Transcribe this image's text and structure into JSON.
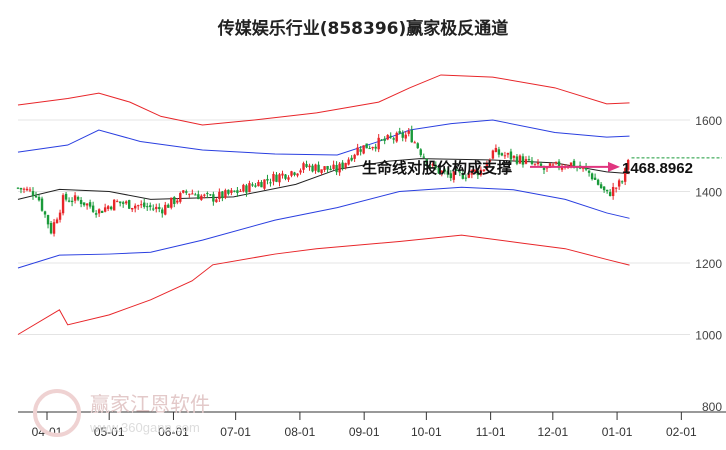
{
  "chart_data": {
    "type": "candlestick",
    "title": "传媒娱乐行业(858396)赢家极反通道",
    "y_ticks": [
      1600,
      1400,
      1200,
      1000,
      800
    ],
    "ylim": [
      800,
      1700
    ],
    "x_ticks": [
      "04-01",
      "05-01",
      "06-01",
      "07-01",
      "08-01",
      "09-01",
      "10-01",
      "11-01",
      "12-01",
      "01-01",
      "02-01"
    ],
    "x_tick_days": [
      0,
      30,
      61,
      91,
      122,
      153,
      183,
      214,
      244,
      275,
      306
    ],
    "close_path": [
      [
        -14,
        1410
      ],
      [
        -5,
        1395
      ],
      [
        2,
        1290
      ],
      [
        8,
        1380
      ],
      [
        16,
        1375
      ],
      [
        25,
        1345
      ],
      [
        33,
        1370
      ],
      [
        45,
        1360
      ],
      [
        55,
        1350
      ],
      [
        68,
        1400
      ],
      [
        78,
        1380
      ],
      [
        90,
        1395
      ],
      [
        100,
        1420
      ],
      [
        115,
        1450
      ],
      [
        125,
        1470
      ],
      [
        140,
        1460
      ],
      [
        150,
        1520
      ],
      [
        165,
        1545
      ],
      [
        175,
        1560
      ],
      [
        185,
        1470
      ],
      [
        195,
        1440
      ],
      [
        210,
        1460
      ],
      [
        215,
        1510
      ],
      [
        228,
        1490
      ],
      [
        240,
        1460
      ],
      [
        252,
        1480
      ],
      [
        262,
        1450
      ],
      [
        270,
        1390
      ],
      [
        278,
        1430
      ],
      [
        281,
        1510
      ]
    ],
    "series": [
      {
        "name": "upper-red",
        "color": "#e8262a",
        "points": [
          [
            -14,
            1642
          ],
          [
            10,
            1660
          ],
          [
            25,
            1675
          ],
          [
            40,
            1650
          ],
          [
            55,
            1610
          ],
          [
            75,
            1586
          ],
          [
            100,
            1600
          ],
          [
            130,
            1620
          ],
          [
            160,
            1650
          ],
          [
            175,
            1690
          ],
          [
            190,
            1726
          ],
          [
            215,
            1720
          ],
          [
            245,
            1690
          ],
          [
            270,
            1645
          ],
          [
            281,
            1648
          ]
        ]
      },
      {
        "name": "upper-blue",
        "color": "#2a3fe0",
        "points": [
          [
            -14,
            1510
          ],
          [
            10,
            1530
          ],
          [
            25,
            1572
          ],
          [
            45,
            1540
          ],
          [
            75,
            1516
          ],
          [
            110,
            1505
          ],
          [
            140,
            1502
          ],
          [
            160,
            1540
          ],
          [
            175,
            1572
          ],
          [
            195,
            1590
          ],
          [
            215,
            1600
          ],
          [
            245,
            1565
          ],
          [
            270,
            1552
          ],
          [
            281,
            1555
          ]
        ]
      },
      {
        "name": "middle",
        "color": "#222222",
        "points": [
          [
            -14,
            1378
          ],
          [
            6,
            1406
          ],
          [
            30,
            1400
          ],
          [
            50,
            1378
          ],
          [
            90,
            1385
          ],
          [
            120,
            1420
          ],
          [
            140,
            1462
          ],
          [
            165,
            1485
          ],
          [
            180,
            1492
          ],
          [
            215,
            1488
          ],
          [
            245,
            1480
          ],
          [
            270,
            1455
          ],
          [
            281,
            1450
          ]
        ]
      },
      {
        "name": "lower-blue",
        "color": "#2a3fe0",
        "points": [
          [
            -14,
            1186
          ],
          [
            6,
            1222
          ],
          [
            30,
            1225
          ],
          [
            50,
            1230
          ],
          [
            75,
            1264
          ],
          [
            110,
            1320
          ],
          [
            140,
            1355
          ],
          [
            170,
            1400
          ],
          [
            200,
            1412
          ],
          [
            225,
            1405
          ],
          [
            250,
            1378
          ],
          [
            270,
            1340
          ],
          [
            281,
            1325
          ]
        ]
      },
      {
        "name": "lower-red",
        "color": "#e8262a",
        "points": [
          [
            -14,
            1000
          ],
          [
            6,
            1069
          ],
          [
            10,
            1027
          ],
          [
            30,
            1055
          ],
          [
            50,
            1097
          ],
          [
            70,
            1150
          ],
          [
            80,
            1195
          ],
          [
            110,
            1225
          ],
          [
            130,
            1240
          ],
          [
            170,
            1260
          ],
          [
            200,
            1278
          ],
          [
            230,
            1255
          ],
          [
            250,
            1240
          ],
          [
            270,
            1210
          ],
          [
            281,
            1194
          ]
        ]
      }
    ],
    "annotation": "生命线对股价构成支撑",
    "last_value_label": "1468.8962",
    "last_value": 1469,
    "dashed_level": 1494,
    "colors": {
      "up": "#e8262a",
      "down": "#1a9a3a",
      "arrow": "#e0357f",
      "dash": "#1a9a3a"
    }
  },
  "watermark": {
    "brand": "赢家江恩软件",
    "url": "www.360gann.com"
  }
}
